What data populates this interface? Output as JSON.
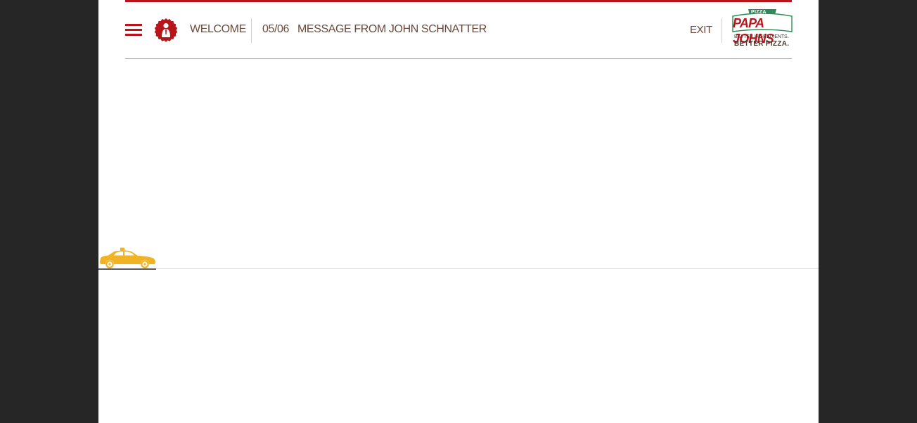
{
  "header": {
    "welcome_label": "WELCOME",
    "chapter_number": "05/06",
    "chapter_title": "MESSAGE FROM JOHN SCHNATTER",
    "exit_label": "EXIT"
  },
  "logo": {
    "pizza_badge": "PIZZA",
    "brand": "PAPA JOHNS",
    "tagline_1": "BETTER INGREDIENTS.",
    "tagline_2": "BETTER PIZZA."
  },
  "icons": {
    "menu": "hamburger-menu-icon",
    "avatar": "founder-badge-icon",
    "vehicle": "taxi-car-icon"
  },
  "colors": {
    "accent": "#b8151b",
    "text": "#6a4a3c",
    "taxi": "#f0b323",
    "logo_green": "#2e8b57",
    "background": "#262626"
  }
}
